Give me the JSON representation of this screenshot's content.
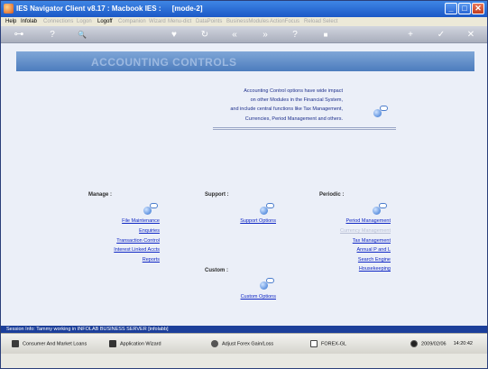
{
  "window": {
    "title": "IES Navigator Client v8.17 : Macbook IES :",
    "mode": "[mode-2]",
    "min_label": "_",
    "max_label": "□",
    "close_label": "✕"
  },
  "menu": {
    "items": [
      {
        "label": "Help",
        "enabled": true
      },
      {
        "label": "Infolab",
        "enabled": true
      },
      {
        "label": "Connections",
        "enabled": false
      },
      {
        "label": "Logon",
        "enabled": false
      },
      {
        "label": "Logoff",
        "enabled": true
      },
      {
        "label": "Companion",
        "enabled": false
      },
      {
        "label": "Wizard",
        "enabled": false
      },
      {
        "label": "Menu-dict",
        "enabled": false
      },
      {
        "label": "DataPoints",
        "enabled": false
      },
      {
        "label": "BusinessModules",
        "enabled": false
      },
      {
        "label": "ActionFocus",
        "enabled": false
      },
      {
        "label": "Reload Select",
        "enabled": false
      }
    ]
  },
  "toolbar": {
    "key": "⊶",
    "help": "?",
    "search": "🔍",
    "heart": "♥",
    "refresh": "↻",
    "back": "«",
    "forward": "»",
    "info": "?",
    "square": "■",
    "plus": "+",
    "check": "✓",
    "close": "✕"
  },
  "page": {
    "title": "ACCOUNTING CONTROLS",
    "description": [
      "Accounting Control options have wide impact",
      "on other Modules in the Financial System,",
      "and include central functions like Tax Management,",
      "Currencies, Period Management and others."
    ]
  },
  "sections": {
    "manage": {
      "title": "Manage :",
      "links": [
        "File Maintenance",
        "Enquiries",
        "Transaction Control",
        "Interest Linked Accts",
        "Reports"
      ]
    },
    "support": {
      "title": "Support :",
      "links": [
        "Support Options"
      ]
    },
    "periodic": {
      "title": "Periodic :",
      "links": [
        "Period Management",
        "Currency Management",
        "Tax Management",
        "Annual P and L",
        "Search Engine",
        "Housekeeping"
      ]
    },
    "custom": {
      "title": "Custom :",
      "links": [
        "Custom Options"
      ]
    }
  },
  "status": {
    "text": "Session Info: Tammy working in INFOLAB BUSINESS SERVER  [infolabb]"
  },
  "taskbar": {
    "items": [
      {
        "label": "Consumer And Market Loans",
        "icon": "document-icon"
      },
      {
        "label": "Application Wizard",
        "icon": "wizard-icon"
      },
      {
        "label": "Adjust Forex Gain/Loss",
        "icon": "forex-icon"
      },
      {
        "label": "FOREX-GL",
        "icon": "folder-icon"
      }
    ],
    "date": "2009/02/06",
    "time": "14:20:42"
  }
}
